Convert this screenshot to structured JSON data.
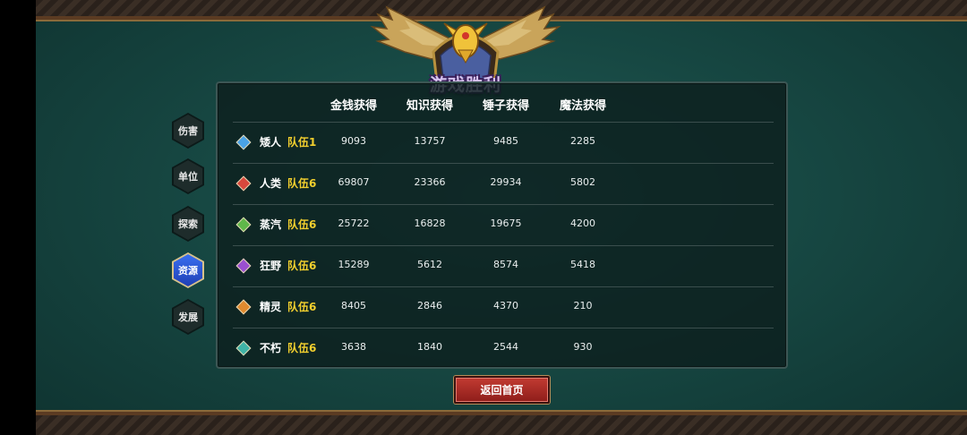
{
  "title": "游戏胜利",
  "side_tabs": [
    {
      "label": "伤害",
      "active": false
    },
    {
      "label": "单位",
      "active": false
    },
    {
      "label": "探索",
      "active": false
    },
    {
      "label": "资源",
      "active": true
    },
    {
      "label": "发展",
      "active": false
    }
  ],
  "columns": [
    "金钱获得",
    "知识获得",
    "锤子获得",
    "魔法获得"
  ],
  "rows": [
    {
      "race": "矮人",
      "team": "队伍1",
      "gem_color": "#4aa3e6",
      "values": [
        "9093",
        "13757",
        "9485",
        "2285"
      ]
    },
    {
      "race": "人类",
      "team": "队伍6",
      "gem_color": "#d8473c",
      "values": [
        "69807",
        "23366",
        "29934",
        "5802"
      ]
    },
    {
      "race": "蒸汽",
      "team": "队伍6",
      "gem_color": "#5fb84a",
      "values": [
        "25722",
        "16828",
        "19675",
        "4200"
      ]
    },
    {
      "race": "狂野",
      "team": "队伍6",
      "gem_color": "#9a4fd1",
      "values": [
        "15289",
        "5612",
        "8574",
        "5418"
      ]
    },
    {
      "race": "精灵",
      "team": "队伍6",
      "gem_color": "#e08a2e",
      "values": [
        "8405",
        "2846",
        "4370",
        "210"
      ]
    },
    {
      "race": "不朽",
      "team": "队伍6",
      "gem_color": "#3fb3a6",
      "values": [
        "3638",
        "1840",
        "2544",
        "930"
      ]
    }
  ],
  "return_button": "返回首页"
}
